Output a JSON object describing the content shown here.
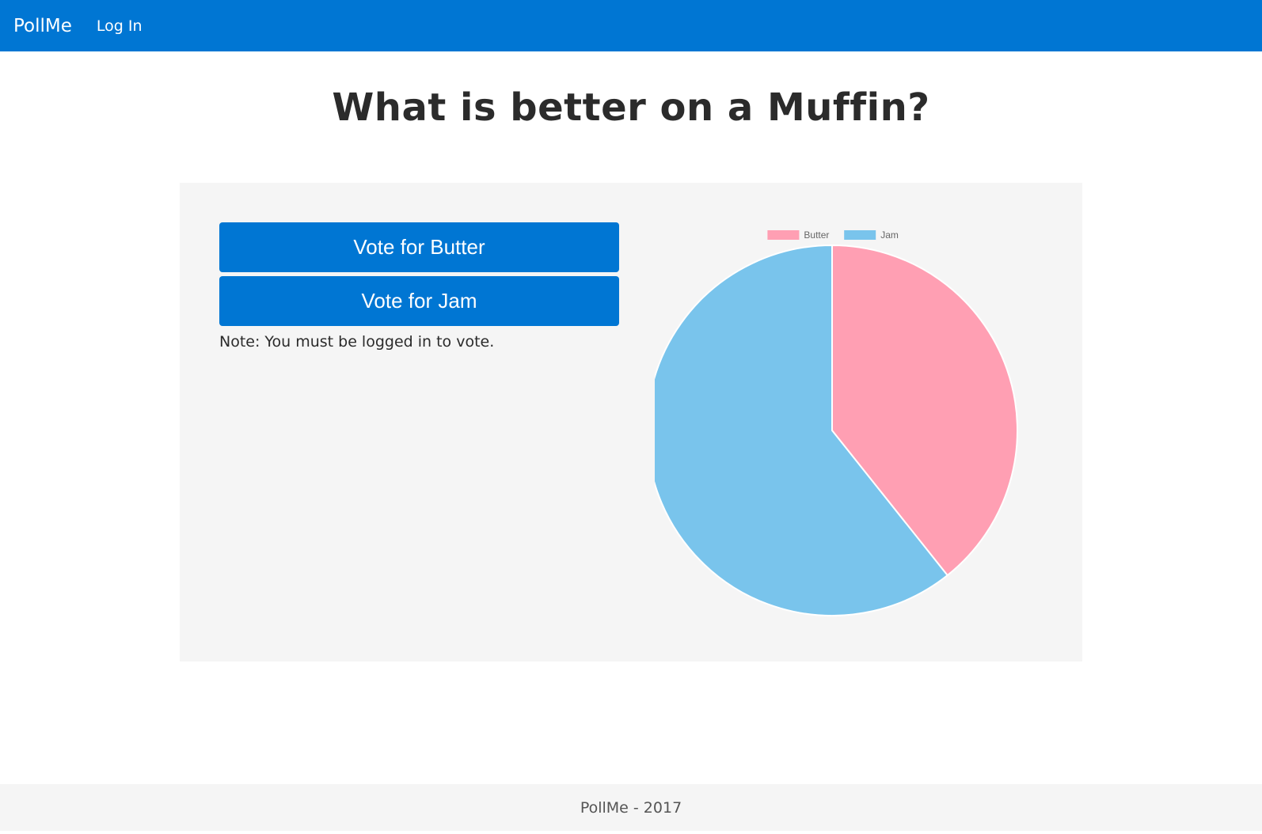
{
  "navbar": {
    "brand": "PollMe",
    "login_label": "Log In"
  },
  "poll": {
    "title": "What is better on a Muffin?",
    "vote_buttons": [
      {
        "label": "Vote for Butter"
      },
      {
        "label": "Vote for Jam"
      }
    ],
    "note": "Note: You must be logged in to vote."
  },
  "colors": {
    "brand_blue": "#0076d3",
    "panel_bg": "#f5f5f5",
    "butter": "#ff9fb3",
    "jam": "#79c4ec"
  },
  "chart_data": {
    "type": "pie",
    "categories": [
      "Butter",
      "Jam"
    ],
    "values": [
      39.3,
      60.7
    ],
    "colors": [
      "#ff9fb3",
      "#79c4ec"
    ],
    "legend": "top-center"
  },
  "footer": {
    "text": "PollMe - 2017"
  }
}
